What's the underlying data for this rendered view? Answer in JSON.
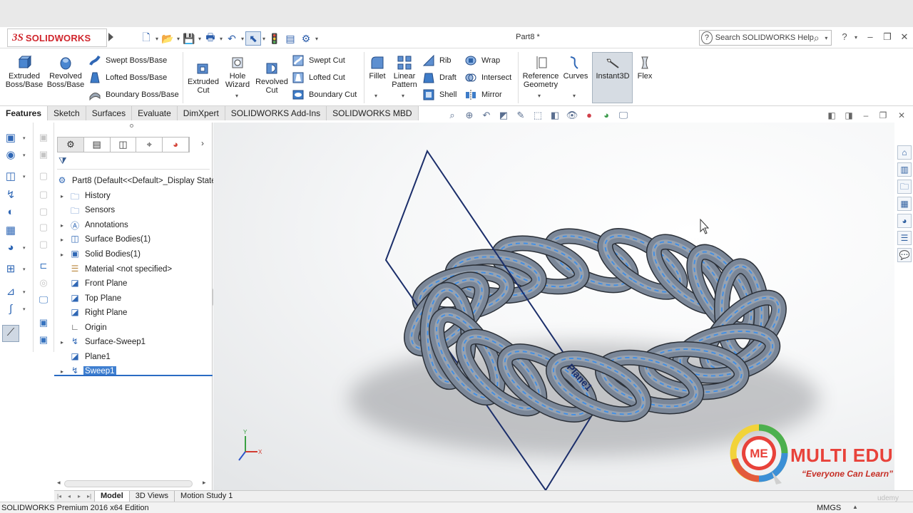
{
  "app": {
    "logo": "SOLIDWORKS",
    "document_title": "Part8 *",
    "help_search_placeholder": "Search SOLIDWORKS Help"
  },
  "ribbon": {
    "buttons": [
      {
        "label1": "Extruded",
        "label2": "Boss/Base"
      },
      {
        "label1": "Revolved",
        "label2": "Boss/Base"
      },
      {
        "label1": "Extruded",
        "label2": "Cut"
      },
      {
        "label1": "Hole",
        "label2": "Wizard"
      },
      {
        "label1": "Revolved",
        "label2": "Cut"
      },
      {
        "label1": "Fillet",
        "label2": ""
      },
      {
        "label1": "Linear",
        "label2": "Pattern"
      },
      {
        "label1": "Reference",
        "label2": "Geometry"
      },
      {
        "label1": "Curves",
        "label2": ""
      },
      {
        "label1": "Instant3D",
        "label2": ""
      },
      {
        "label1": "Flex",
        "label2": ""
      }
    ],
    "small": {
      "swept_boss": "Swept Boss/Base",
      "lofted_boss": "Lofted Boss/Base",
      "boundary_boss": "Boundary Boss/Base",
      "swept_cut": "Swept Cut",
      "lofted_cut": "Lofted Cut",
      "boundary_cut": "Boundary Cut",
      "rib": "Rib",
      "draft": "Draft",
      "shell": "Shell",
      "wrap": "Wrap",
      "intersect": "Intersect",
      "mirror": "Mirror"
    }
  },
  "tabs": [
    "Features",
    "Sketch",
    "Surfaces",
    "Evaluate",
    "DimXpert",
    "SOLIDWORKS Add-Ins",
    "SOLIDWORKS MBD"
  ],
  "feature_tree": {
    "root": "Part8  (Default<<Default>_Display State",
    "items": [
      "History",
      "Sensors",
      "Annotations",
      "Surface Bodies(1)",
      "Solid Bodies(1)",
      "Material <not specified>",
      "Front Plane",
      "Top Plane",
      "Right Plane",
      "Origin",
      "Surface-Sweep1",
      "Plane1",
      "Sweep1"
    ],
    "selected": "Sweep1"
  },
  "viewport": {
    "plane_label": "Plane1",
    "triad_x": "X",
    "triad_y": "Y",
    "model_color": "#7b8798",
    "path_color": "#3d8ee8"
  },
  "bottom_tabs": [
    "Model",
    "3D Views",
    "Motion Study 1"
  ],
  "status": {
    "edition": "SOLIDWORKS Premium 2016 x64 Edition",
    "units": "MMGS"
  },
  "watermark": {
    "badge": "ME",
    "title": "MULTI EDU",
    "subtitle": "“Everyone Can Learn”",
    "udemy": "udemy"
  }
}
